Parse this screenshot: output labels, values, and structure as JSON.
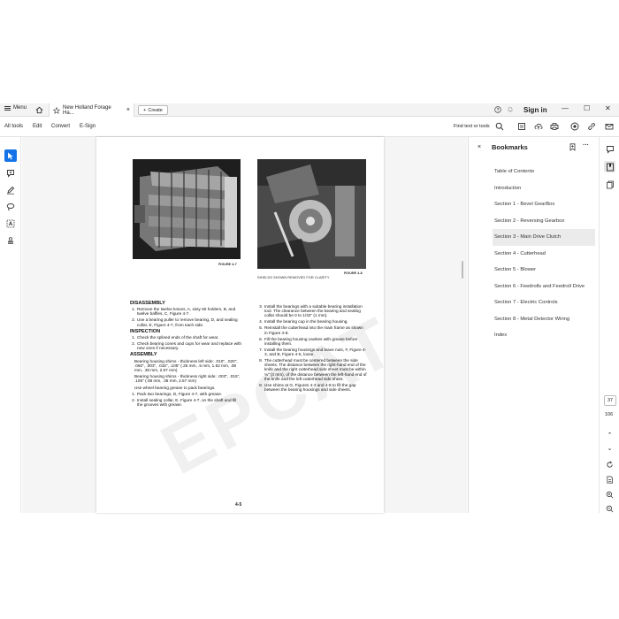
{
  "titlebar": {
    "menu_label": "Menu",
    "tab_title": "New Holland Forage Ha...",
    "tab_close": "×",
    "create_label": "Create",
    "signin_label": "Sign in"
  },
  "toolbar": {
    "all_tools": "All tools",
    "edit": "Edit",
    "convert": "Convert",
    "esign": "E-Sign",
    "find_label": "Find text or tools"
  },
  "document": {
    "figure1_caption": "FIGURE 4-7",
    "figure2_caption": "FIGURE 4-8",
    "figure2_note": "SHIELDS SHOWN REMOVED FOR CLARITY",
    "page_number": "4-5",
    "watermark": "EPCATPRO.COM",
    "left": {
      "h_disassembly": "DISASSEMBLY",
      "d1": "Remove the twelve knives, A, sixty 60 holders, B, and twelve baffles, C, Figure 4-7.",
      "d2": "Use a bearing puller to remove bearing, D, and sealing collar, E, Figure 4-7, from each side.",
      "h_inspection": "INSPECTION",
      "i1": "Check the splined ends of the shaft for wear.",
      "i2": "Check bearing cones and cups for wear and replace with new ones if necessary.",
      "h_assembly": "ASSEMBLY",
      "a_p1": "Bearing housing shims - thickness left side: .010\", .020\", .060\", .003\", .015\", .105\" (.25 mm, .5 mm, 1.52 mm, .08 mm, .38 mm, 2.67 mm)",
      "a_p2": "Bearing housing shims - thickness right side: .003\", .015\", .105\" (.08 mm, .38 mm, 2.67 mm)",
      "a_p3": "Use wheel bearing grease to pack bearings.",
      "a1": "Pack two bearings, D, Figure 4-7, with grease.",
      "a2": "Install sealing collar, E, Figure 4-7, on the shaft and fill the grooves with grease."
    },
    "right": {
      "r3": "Install the bearings with a suitable bearing installation tool. The clearance between the bearing and sealing collar should be 0 to 1/32\" (1 mm).",
      "r4": "Install the bearing cup in the bearing housing.",
      "r5": "Reinstall the cutterhead into the main frame as shown in Figure 4-8.",
      "r6": "Fill the bearing housing cavities with grease before installing them.",
      "r7": "Install the bearing housings and leave nuts, F, Figure 4-3, and B, Figure 4-5, loose.",
      "r8": "The cutterhead must be centered between the side sheets. The distance between the right-hand end of the knife and the right cutterhead side sheet must be within ⅛\" (3 mm), of the distance between the left-hand end of the knife and the left cutterhead side sheet.",
      "r9": "Use shims at G, Figures 4-3 and 4-8 to fill the gap between the bearing housings and side sheets."
    }
  },
  "bookmarks": {
    "title": "Bookmarks",
    "close": "×",
    "more": "···",
    "items": [
      "Table of Contents",
      "Introduction",
      "Section 1 - Bevel GearBox",
      "Section 2 - Reversing Gearbox",
      "Section 3 - Main Drive Clutch",
      "Section 4 - Cutterhead",
      "Section 5 - Blower",
      "Section 6 - Feedrolls and Feedroll Drive",
      "Section 7 - Electric Controls",
      "Section 8 - Metal Detector Wiring",
      "Index"
    ],
    "selected_index": 4
  },
  "pager": {
    "current": "37",
    "total": "106"
  },
  "colors": {
    "accent": "#1473e6",
    "selected_bg": "#ebebeb"
  }
}
